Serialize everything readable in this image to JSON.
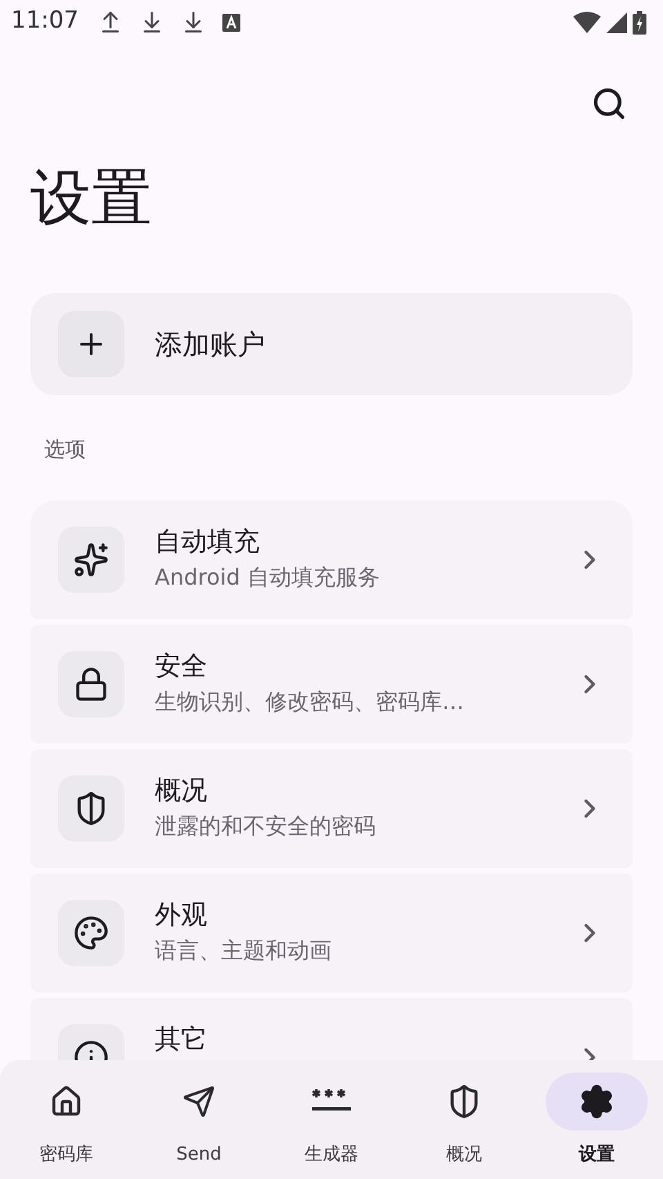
{
  "status_bar": {
    "time": "11:07"
  },
  "title": "设置",
  "add_account": {
    "label": "添加账户"
  },
  "section_label": "选项",
  "settings": [
    {
      "title": "自动填充",
      "subtitle": "Android 自动填充服务"
    },
    {
      "title": "安全",
      "subtitle": "生物识别、修改密码、密码库…"
    },
    {
      "title": "概况",
      "subtitle": "泄露的和不安全的密码"
    },
    {
      "title": "外观",
      "subtitle": "语言、主题和动画"
    },
    {
      "title": "其它"
    }
  ],
  "nav": [
    {
      "label": "密码库",
      "selected": false
    },
    {
      "label": "Send",
      "selected": false
    },
    {
      "label": "生成器",
      "selected": false
    },
    {
      "label": "概况",
      "selected": false
    },
    {
      "label": "设置",
      "selected": true
    }
  ]
}
